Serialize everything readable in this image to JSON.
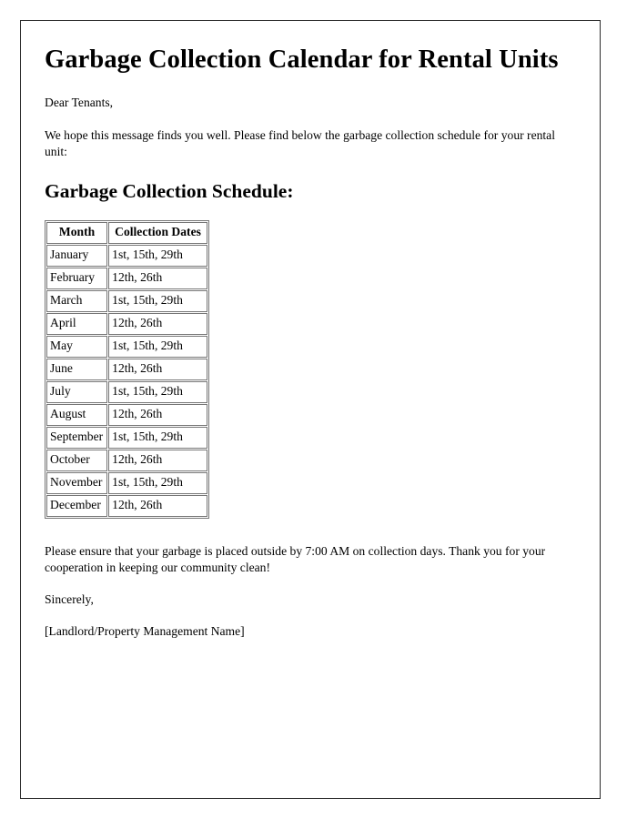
{
  "document": {
    "title": "Garbage Collection Calendar for Rental Units",
    "salutation": "Dear Tenants,",
    "intro_paragraph": "We hope this message finds you well. Please find below the garbage collection schedule for your rental unit:",
    "section_heading": "Garbage Collection Schedule:",
    "notice_paragraph": "Please ensure that your garbage is placed outside by 7:00 AM on collection days. Thank you for your cooperation in keeping our community clean!",
    "closing": "Sincerely,",
    "signature": "[Landlord/Property Management Name]"
  },
  "schedule_table": {
    "columns": [
      "Month",
      "Collection Dates"
    ],
    "rows": [
      {
        "month": "January",
        "dates": "1st, 15th, 29th"
      },
      {
        "month": "February",
        "dates": "12th, 26th"
      },
      {
        "month": "March",
        "dates": "1st, 15th, 29th"
      },
      {
        "month": "April",
        "dates": "12th, 26th"
      },
      {
        "month": "May",
        "dates": "1st, 15th, 29th"
      },
      {
        "month": "June",
        "dates": "12th, 26th"
      },
      {
        "month": "July",
        "dates": "1st, 15th, 29th"
      },
      {
        "month": "August",
        "dates": "12th, 26th"
      },
      {
        "month": "September",
        "dates": "1st, 15th, 29th"
      },
      {
        "month": "October",
        "dates": "12th, 26th"
      },
      {
        "month": "November",
        "dates": "1st, 15th, 29th"
      },
      {
        "month": "December",
        "dates": "12th, 26th"
      }
    ]
  },
  "colors": {
    "page_border": "#2b2b2b",
    "table_border": "#767676",
    "text": "#000000",
    "background": "#ffffff"
  }
}
